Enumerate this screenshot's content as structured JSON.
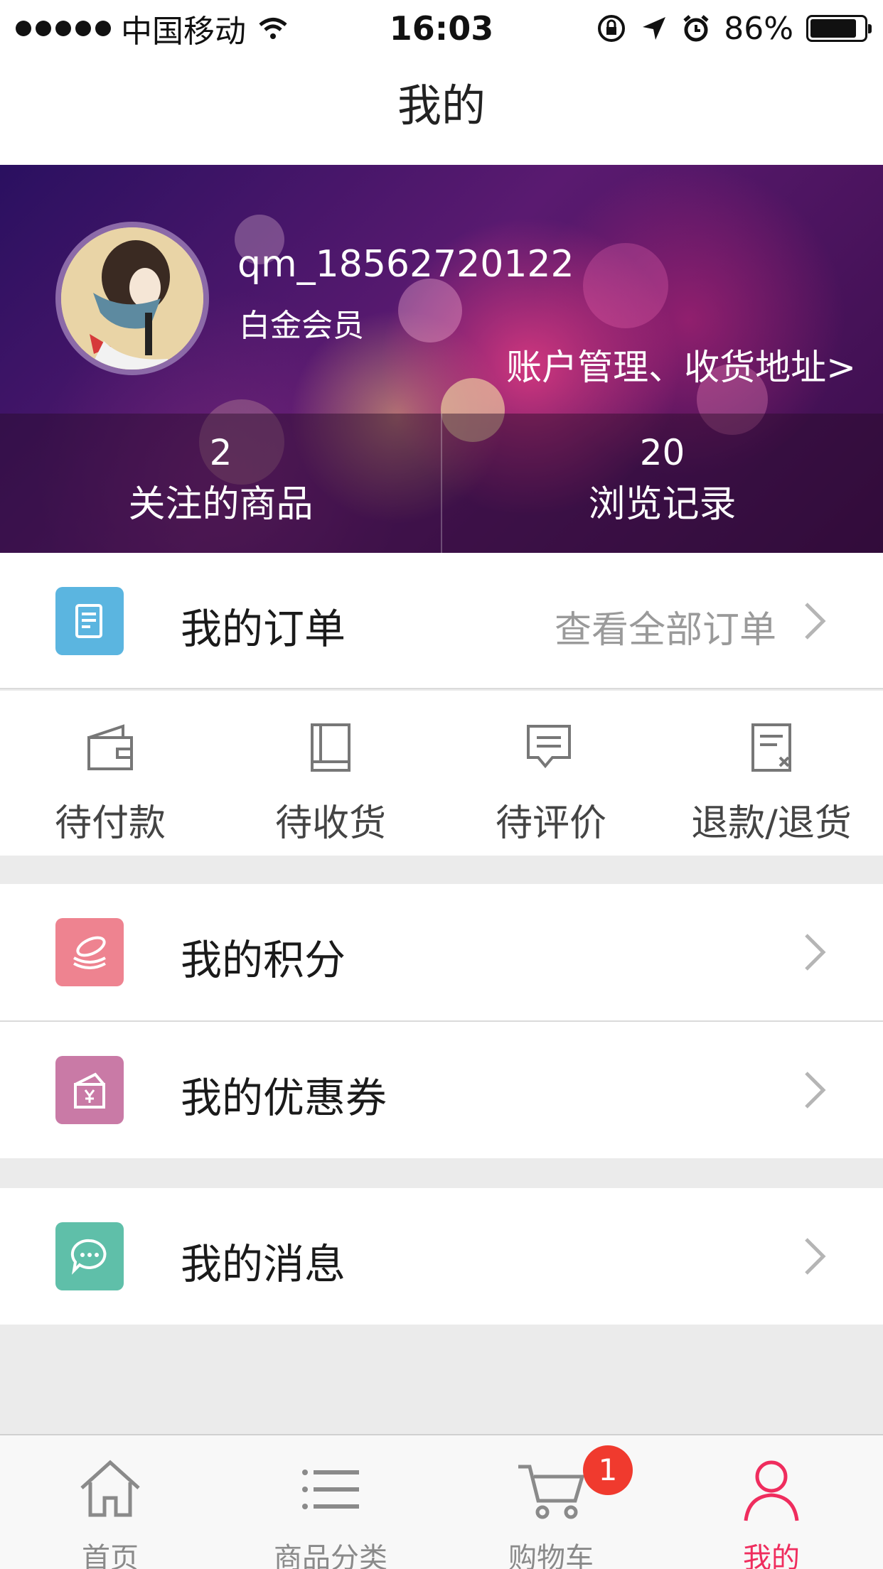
{
  "status_bar": {
    "carrier": "中国移动",
    "time": "16:03",
    "battery": "86%",
    "battery_level": 0.86
  },
  "nav": {
    "title": "我的"
  },
  "profile": {
    "username": "qm_18562720122",
    "member_level": "白金会员",
    "account_link": "账户管理、收货地址>",
    "stats": [
      {
        "value": "2",
        "label": "关注的商品"
      },
      {
        "value": "20",
        "label": "浏览记录"
      }
    ]
  },
  "orders": {
    "title": "我的订单",
    "view_all": "查看全部订单",
    "icon": "order-document-icon",
    "icon_color": "#5bb5e0",
    "statuses": [
      {
        "label": "待付款",
        "icon": "wallet-icon"
      },
      {
        "label": "待收货",
        "icon": "book-icon"
      },
      {
        "label": "待评价",
        "icon": "comment-icon"
      },
      {
        "label": "退款/退货",
        "icon": "refund-icon"
      }
    ]
  },
  "menu": {
    "points": {
      "title": "我的积分",
      "icon": "coins-icon",
      "icon_color": "#ee8390"
    },
    "coupons": {
      "title": "我的优惠券",
      "icon": "coupon-icon",
      "icon_color": "#c97aa6"
    },
    "messages": {
      "title": "我的消息",
      "icon": "chat-bubble-icon",
      "icon_color": "#5fbfa9"
    }
  },
  "tabbar": {
    "tabs": [
      {
        "label": "首页",
        "icon": "home-icon"
      },
      {
        "label": "商品分类",
        "icon": "list-icon"
      },
      {
        "label": "购物车",
        "icon": "cart-icon",
        "badge": "1"
      },
      {
        "label": "我的",
        "icon": "person-icon",
        "active": true
      }
    ],
    "active_color": "#ef2d5e"
  }
}
